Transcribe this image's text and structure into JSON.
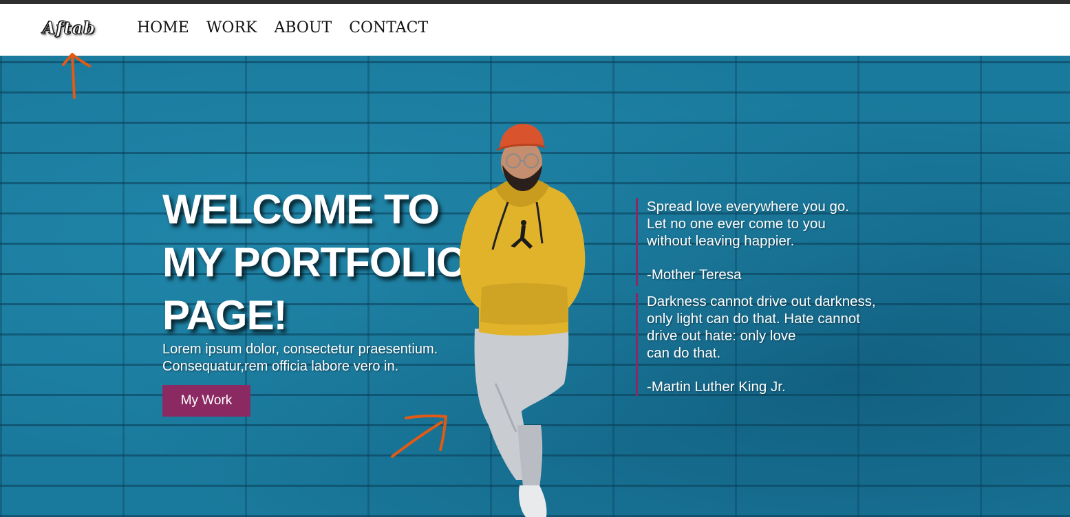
{
  "logo": {
    "text": "Aftab"
  },
  "nav": {
    "items": [
      "HOME",
      "WORK",
      "ABOUT",
      "CONTACT"
    ]
  },
  "hero": {
    "heading_lines": [
      "WELCOME TO",
      "MY PORTFOLIO",
      "PAGE!"
    ],
    "subtext_lines": [
      "Lorem ipsum dolor, consectetur praesentium.",
      "Consequatur,rem officia labore vero in."
    ],
    "button_label": "My Work",
    "quotes": [
      {
        "lines": [
          "Spread love everywhere you go.",
          "Let no one ever come to you",
          "without leaving happier."
        ],
        "author": "-Mother Teresa"
      },
      {
        "lines": [
          "Darkness cannot drive out darkness,",
          "only light can do that. Hate cannot",
          "drive out hate: only love",
          "can do that."
        ],
        "author": "-Martin Luther King Jr."
      }
    ]
  },
  "colors": {
    "navbar_bg": "#ffffff",
    "hero_bg": "#1a7a9d",
    "accent": "#8b2a62",
    "arrow": "#e35a14",
    "hoodie": "#e0b32a",
    "cap": "#d9532d"
  }
}
